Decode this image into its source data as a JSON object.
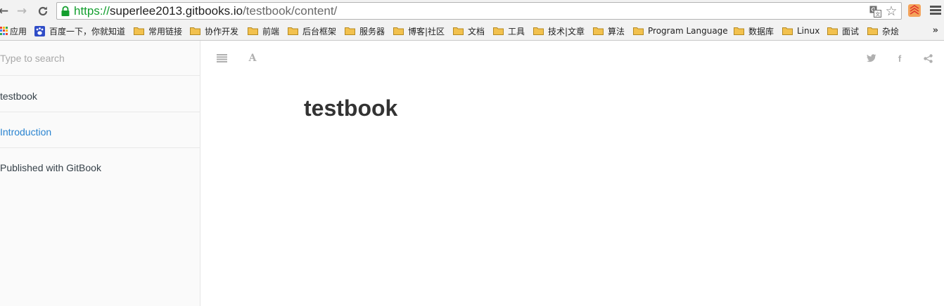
{
  "browser": {
    "url_scheme": "https://",
    "url_host": "superlee2013.gitbooks.io",
    "url_path": "/testbook/content/",
    "bookmarks": [
      "应用",
      "百度一下，你就知道",
      "常用链接",
      "协作开发",
      "前端",
      "后台框架",
      "服务器",
      "博客|社区",
      "文档",
      "工具",
      "技术|文章",
      "算法",
      "Program Language",
      "数据库",
      "Linux",
      "面试",
      "杂烩"
    ],
    "more_bookmarks": "»"
  },
  "sidebar": {
    "search_placeholder": "Type to search",
    "items": [
      {
        "label": "testbook"
      },
      {
        "label": "Introduction"
      },
      {
        "label": "Published with GitBook"
      }
    ]
  },
  "content": {
    "title": "testbook"
  },
  "colors": {
    "link_active": "#2a84d0",
    "https_green": "#139e2e",
    "folder_yellow": "#f2c14e"
  }
}
